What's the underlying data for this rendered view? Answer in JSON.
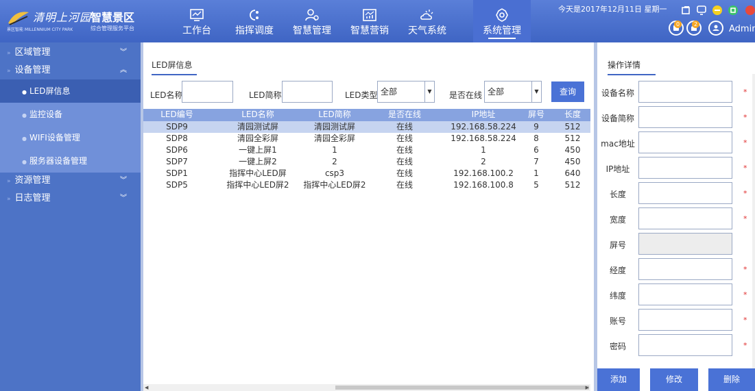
{
  "header": {
    "logo_cn": "清明上河园",
    "logo_title": "智慧景区",
    "logo_en": "景区智能 MILLENNIUM CITY PARK",
    "logo_sub": "综合管理服务平台",
    "nav": [
      {
        "label": "工作台",
        "icon": "monitor-icon"
      },
      {
        "label": "指挥调度",
        "icon": "dispatch-icon"
      },
      {
        "label": "智慧管理",
        "icon": "users-icon"
      },
      {
        "label": "智慧营销",
        "icon": "chart-icon"
      },
      {
        "label": "天气系统",
        "icon": "weather-icon"
      },
      {
        "label": "系统管理",
        "icon": "gear-icon",
        "active": true
      }
    ],
    "date_text": "今天是2017年12月11日 星期一",
    "badge_msg": "0",
    "badge_alert": "2",
    "user_name": "Admin"
  },
  "sidebar": {
    "groups": [
      {
        "label": "区域管理",
        "chevron": "collapsed"
      },
      {
        "label": "设备管理",
        "chevron": "expanded"
      },
      {
        "label": "资源管理",
        "chevron": "collapsed"
      },
      {
        "label": "日志管理",
        "chevron": "collapsed"
      }
    ],
    "device_items": [
      {
        "label": "LED屏信息",
        "active": true
      },
      {
        "label": "监控设备"
      },
      {
        "label": "WIFI设备管理"
      },
      {
        "label": "服务器设备管理"
      }
    ]
  },
  "main": {
    "tab": "LED屏信息",
    "filters": {
      "name_label": "LED名称",
      "name_value": "",
      "short_label": "LED简称",
      "short_value": "",
      "type_label": "LED类型",
      "type_value": "全部",
      "online_label": "是否在线",
      "online_value": "全部",
      "search": "查询"
    },
    "columns": [
      "LED编号",
      "LED名称",
      "LED简称",
      "是否在线",
      "IP地址",
      "屏号",
      "长度"
    ],
    "rows": [
      [
        "SDP9",
        "清园测试屏",
        "清园测试屏",
        "在线",
        "192.168.58.224",
        "9",
        "512"
      ],
      [
        "SDP8",
        "清园全彩屏",
        "清园全彩屏",
        "在线",
        "192.168.58.224",
        "8",
        "512"
      ],
      [
        "SDP6",
        "一键上屏1",
        "1",
        "在线",
        "1",
        "6",
        "450"
      ],
      [
        "SDP7",
        "一键上屏2",
        "2",
        "在线",
        "2",
        "7",
        "450"
      ],
      [
        "SDP1",
        "指挥中心LED屏",
        "csp3",
        "在线",
        "192.168.100.2",
        "1",
        "640"
      ],
      [
        "SDP5",
        "指挥中心LED屏2",
        "指挥中心LED屏2",
        "在线",
        "192.168.100.8",
        "5",
        "512"
      ]
    ],
    "selected_row": 0
  },
  "detail": {
    "tab": "操作详情",
    "fields": [
      {
        "label": "设备名称",
        "required": true
      },
      {
        "label": "设备简称",
        "required": true
      },
      {
        "label": "mac地址",
        "required": true
      },
      {
        "label": "IP地址",
        "required": true
      },
      {
        "label": "长度",
        "required": true
      },
      {
        "label": "宽度",
        "required": true
      },
      {
        "label": "屏号",
        "required": false,
        "disabled": true
      },
      {
        "label": "经度",
        "required": true
      },
      {
        "label": "纬度",
        "required": true
      },
      {
        "label": "账号",
        "required": true
      },
      {
        "label": "密码",
        "required": true
      }
    ],
    "required_mark": "*",
    "buttons": {
      "add": "添加",
      "edit": "修改",
      "delete": "删除"
    }
  },
  "colors": {
    "header": "#3f65c4",
    "sidebar": "#4d73c6",
    "table_head": "#87a3e0",
    "row_selected": "#c6d4f0",
    "button": "#4a72d6",
    "required": "#e03030"
  }
}
